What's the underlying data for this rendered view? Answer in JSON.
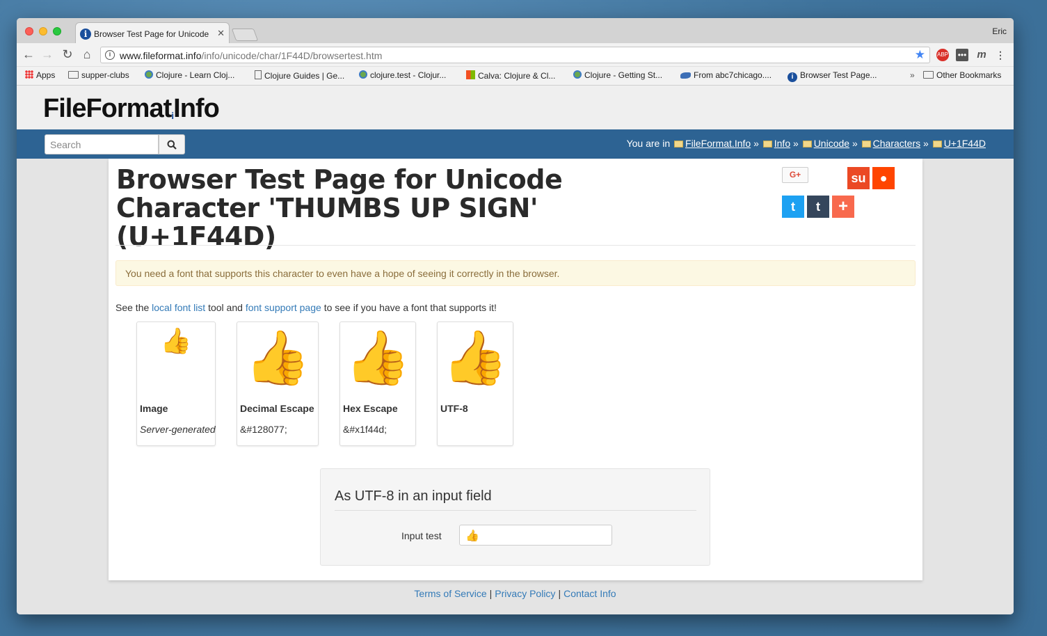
{
  "browser": {
    "tab_title": "Browser Test Page for Unicode",
    "profile_name": "Eric",
    "url_host": "www.fileformat.info",
    "url_path": "/info/unicode/char/1F44D/browsertest.htm",
    "bookmarks": [
      {
        "label": "Apps",
        "icon": "apps-icon"
      },
      {
        "label": "supper-clubs",
        "icon": "folder-icon"
      },
      {
        "label": "Clojure - Learn Cloj...",
        "icon": "clojure-icon"
      },
      {
        "label": "Clojure Guides | Ge...",
        "icon": "page-icon"
      },
      {
        "label": "clojure.test - Clojur...",
        "icon": "clojure-icon"
      },
      {
        "label": "Calva: Clojure & Cl...",
        "icon": "microsoft-icon"
      },
      {
        "label": "Clojure - Getting St...",
        "icon": "clojure-icon"
      },
      {
        "label": "From abc7chicago....",
        "icon": "link-icon"
      },
      {
        "label": "Browser Test Page...",
        "icon": "info-icon"
      }
    ],
    "overflow_label": "»",
    "other_bookmarks": "Other Bookmarks"
  },
  "site": {
    "logo_text_1": "FileFormat",
    "logo_dot": "i",
    "logo_text_2": "Info",
    "search_placeholder": "Search",
    "breadcrumb_prefix": "You are in",
    "breadcrumbs": [
      "FileFormat.Info",
      "Info",
      "Unicode",
      "Characters",
      "U+1F44D"
    ],
    "breadcrumb_separator": "»"
  },
  "main": {
    "title": "Browser Test Page for Unicode Character 'THUMBS UP SIGN' (U+1F44D)",
    "alert": "You need a font that supports this character to even have a hope of seeing it correctly in the browser.",
    "see_prefix": "See the",
    "link_local_font_list": "local font list",
    "see_middle": "tool and",
    "link_font_support": "font support page",
    "see_suffix": "to see if you have a font that supports it!",
    "cards": [
      {
        "label": "Image",
        "sub": "Server-generated",
        "glyph": "👍"
      },
      {
        "label": "Decimal Escape",
        "sub": "&#128077;",
        "glyph": "👍"
      },
      {
        "label": "Hex Escape",
        "sub": "&#x1f44d;",
        "glyph": "👍"
      },
      {
        "label": "UTF-8",
        "sub": "",
        "glyph": "👍"
      }
    ],
    "panel_title": "As UTF-8 in an input field",
    "input_label": "Input test",
    "input_value": "👍"
  },
  "social": {
    "gplus": "G+",
    "stumbleupon": "su",
    "reddit": "●",
    "twitter": "t",
    "tumblr": "t",
    "more": "+"
  },
  "footer": {
    "links": [
      "Terms of Service",
      "Privacy Policy",
      "Contact Info"
    ],
    "separator": "|"
  },
  "colors": {
    "nav_bar": "#2d6393",
    "link": "#337ab7",
    "alert_bg": "#fcf8e3",
    "twitter": "#1da1f2",
    "tumblr": "#35465c",
    "reddit": "#ff4500",
    "stumbleupon": "#eb4924",
    "addthis": "#f8694d"
  }
}
